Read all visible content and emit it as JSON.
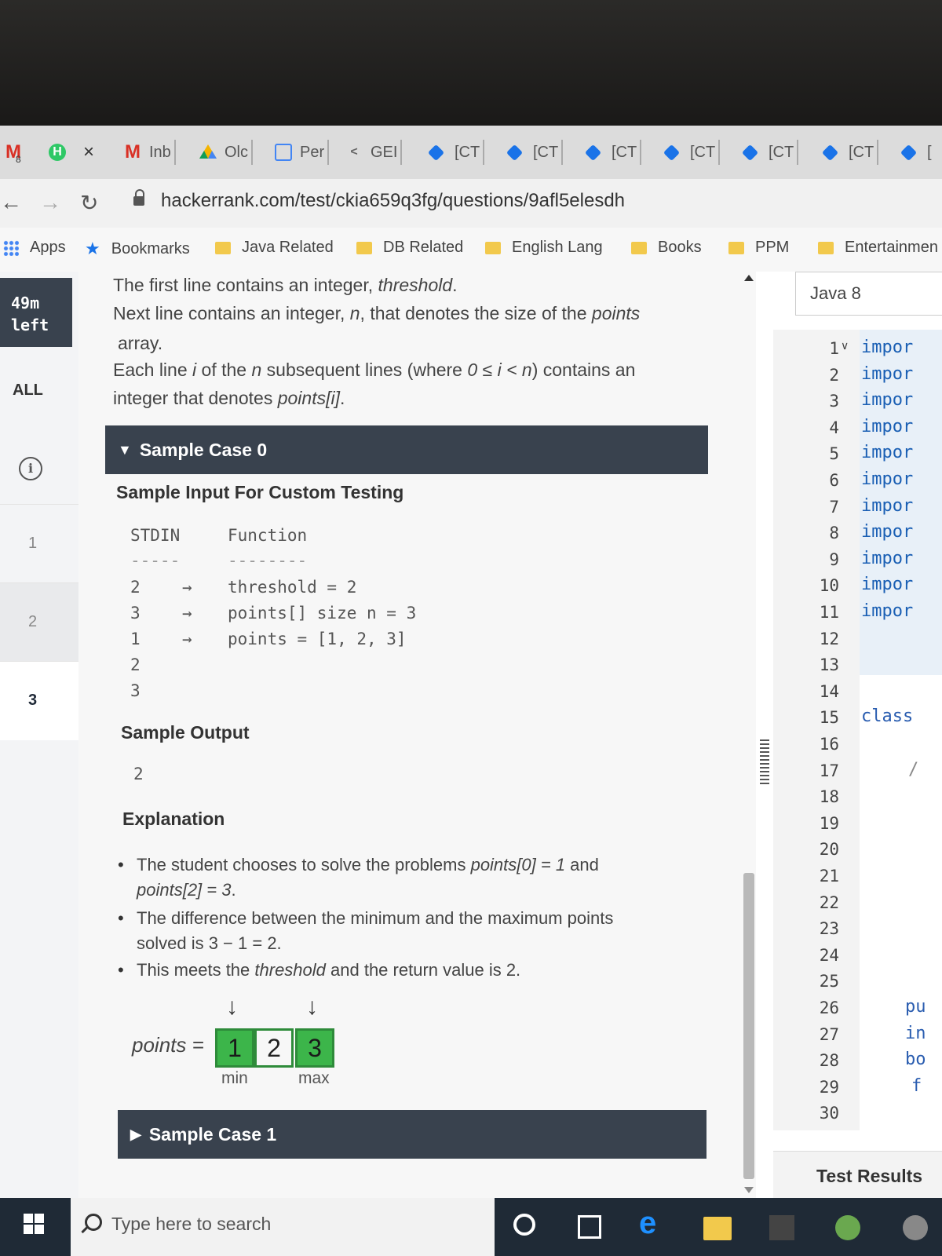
{
  "tabs": [
    {
      "icon": "gmail-icon",
      "label": ""
    },
    {
      "icon": "hackerrank-icon",
      "label": ""
    },
    {
      "icon": "gmail-icon",
      "label": "Inb"
    },
    {
      "icon": "drive-icon",
      "label": "Olc"
    },
    {
      "icon": "doc-icon",
      "label": "Per"
    },
    {
      "icon": "code-icon",
      "label": "GEI"
    },
    {
      "icon": "diamond-icon",
      "label": "[CT"
    },
    {
      "icon": "diamond-icon",
      "label": "[CT"
    },
    {
      "icon": "diamond-icon",
      "label": "[CT"
    },
    {
      "icon": "diamond-icon",
      "label": "[CT"
    },
    {
      "icon": "diamond-icon",
      "label": "[CT"
    },
    {
      "icon": "diamond-icon",
      "label": "[CT"
    },
    {
      "icon": "diamond-icon",
      "label": "["
    }
  ],
  "tab_badge": "8",
  "tab_close": "×",
  "address": {
    "url": "hackerrank.com/test/ckia659q3fg/questions/9afl5elesdh"
  },
  "bookmarks": [
    "Apps",
    "Bookmarks",
    "Java Related",
    "DB Related",
    "English Lang",
    "Books",
    "PPM",
    "Entertainmen"
  ],
  "left_nav": {
    "timer": [
      "49m",
      "left"
    ],
    "all": "ALL",
    "questions": [
      "1",
      "2",
      "3"
    ]
  },
  "problem": {
    "line1_a": "The first line contains an integer, ",
    "line1_b": "threshold",
    "line1_c": ".",
    "line2_a": "Next line contains an integer, ",
    "line2_b": "n",
    "line2_c": ", that denotes the size of the ",
    "line2_d": "points",
    "line3": "array.",
    "line4_a": "Each line ",
    "line4_b": "i",
    "line4_c": " of the ",
    "line4_d": "n",
    "line4_e": " subsequent lines (where ",
    "line4_f": "0 ≤ i < n",
    "line4_g": ") contains an",
    "line5_a": "integer that denotes ",
    "line5_b": "points[i]",
    "line5_c": "."
  },
  "sample0": {
    "header": "Sample Case 0",
    "input_title": "Sample Input For Custom Testing",
    "stdin_head": "STDIN",
    "func_head": "Function",
    "stdin_rule": "-----",
    "func_rule": "--------",
    "rows": [
      {
        "stdin": "2",
        "arrow": "→",
        "func": "threshold = 2"
      },
      {
        "stdin": "3",
        "arrow": "→",
        "func": "points[] size n = 3"
      },
      {
        "stdin": "1",
        "arrow": "→",
        "func": "points = [1, 2, 3]"
      },
      {
        "stdin": "2",
        "arrow": "",
        "func": ""
      },
      {
        "stdin": "3",
        "arrow": "",
        "func": ""
      }
    ],
    "output_title": "Sample Output",
    "output": "2",
    "explanation_title": "Explanation",
    "bullets": [
      {
        "a": "The student chooses to solve the problems ",
        "b": "points[0] = 1",
        "c": " and",
        "d": "points[2] = 3",
        "e": "."
      },
      {
        "a": "The difference between the minimum and the maximum points",
        "b": "solved is 3 − 1 = 2."
      },
      {
        "a": "This meets the ",
        "b": "threshold",
        "c": " and the return value is 2."
      }
    ],
    "diagram": {
      "label": "points =",
      "values": [
        "1",
        "2",
        "3"
      ],
      "highlight": [
        true,
        false,
        true
      ],
      "arrow": "↓",
      "min_label": "min",
      "max_label": "max"
    }
  },
  "sample1": {
    "header": "Sample Case 1"
  },
  "editor": {
    "language": "Java 8",
    "line_numbers": [
      "1",
      "2",
      "3",
      "4",
      "5",
      "6",
      "7",
      "8",
      "9",
      "10",
      "11",
      "12",
      "13",
      "14",
      "15",
      "16",
      "17",
      "18",
      "19",
      "20",
      "21",
      "22",
      "23",
      "24",
      "25",
      "26",
      "27",
      "28",
      "29",
      "30"
    ],
    "code_lines": [
      "impor",
      "impor",
      "impor",
      "impor",
      "impor",
      "impor",
      "impor",
      "impor",
      "impor",
      "impor",
      "impor"
    ],
    "class_kw": "class",
    "frag_17": "/",
    "frag_26": "pu",
    "frag_27": "in",
    "frag_28": "bo",
    "frag_29": "f",
    "test_results": "Test Results"
  },
  "taskbar": {
    "search_placeholder": "Type here to search"
  },
  "colors": {
    "header_dark": "#39424e",
    "highlight_green": "#3cb54a",
    "code_blue": "#1a5fb4"
  }
}
